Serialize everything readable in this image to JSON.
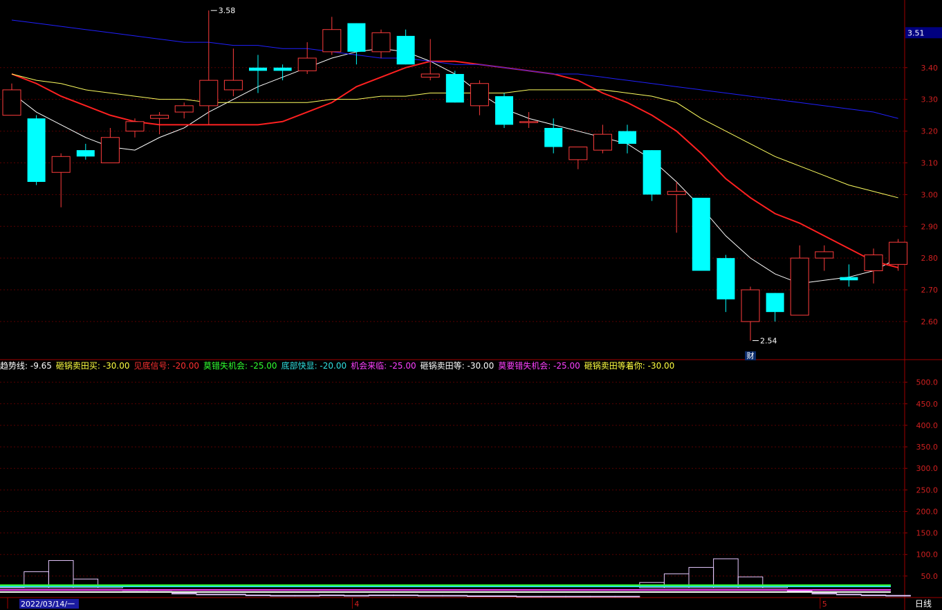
{
  "chart_data": {
    "type": "candlestick",
    "period_label": "日线",
    "price_axis": {
      "ticks": [
        3.4,
        3.3,
        3.2,
        3.1,
        3.0,
        2.9,
        2.8,
        2.7,
        2.6
      ],
      "tick_labels": [
        "3.40",
        "3.30",
        "3.20",
        "3.10",
        "3.00",
        "2.90",
        "2.80",
        "2.70",
        "2.60"
      ],
      "range": [
        2.48,
        3.6
      ],
      "current_price_label": "3.51"
    },
    "indicator_axis": {
      "ticks": [
        500,
        450,
        400,
        350,
        300,
        250,
        200,
        150,
        100,
        50
      ],
      "tick_labels": [
        "500.0",
        "450.0",
        "400.0",
        "350.0",
        "300.0",
        "250.0",
        "200.0",
        "150.0",
        "100.0",
        "50.0"
      ],
      "range": [
        0,
        530
      ]
    },
    "x_axis_labels": [
      {
        "index": 0,
        "text": "2022/03/14/一"
      },
      {
        "index": 14,
        "text": "4"
      },
      {
        "index": 33,
        "text": "5"
      }
    ],
    "annotations": [
      {
        "index": 8,
        "value": 3.58,
        "text": "3.58"
      },
      {
        "index": 30,
        "value": 2.54,
        "text": "2.54"
      },
      {
        "index": 30,
        "text": "财"
      }
    ],
    "candles": [
      {
        "o": 3.25,
        "h": 3.35,
        "l": 3.25,
        "c": 3.33
      },
      {
        "o": 3.24,
        "h": 3.25,
        "l": 3.03,
        "c": 3.04
      },
      {
        "o": 3.07,
        "h": 3.13,
        "l": 2.96,
        "c": 3.12
      },
      {
        "o": 3.14,
        "h": 3.16,
        "l": 3.11,
        "c": 3.12
      },
      {
        "o": 3.1,
        "h": 3.21,
        "l": 3.1,
        "c": 3.18
      },
      {
        "o": 3.2,
        "h": 3.24,
        "l": 3.18,
        "c": 3.23
      },
      {
        "o": 3.24,
        "h": 3.26,
        "l": 3.19,
        "c": 3.25
      },
      {
        "o": 3.26,
        "h": 3.29,
        "l": 3.24,
        "c": 3.28
      },
      {
        "o": 3.28,
        "h": 3.58,
        "l": 3.22,
        "c": 3.36
      },
      {
        "o": 3.33,
        "h": 3.46,
        "l": 3.31,
        "c": 3.36
      },
      {
        "o": 3.4,
        "h": 3.44,
        "l": 3.32,
        "c": 3.39
      },
      {
        "o": 3.4,
        "h": 3.41,
        "l": 3.36,
        "c": 3.39
      },
      {
        "o": 3.39,
        "h": 3.48,
        "l": 3.38,
        "c": 3.43
      },
      {
        "o": 3.45,
        "h": 3.56,
        "l": 3.44,
        "c": 3.52
      },
      {
        "o": 3.54,
        "h": 3.54,
        "l": 3.41,
        "c": 3.45
      },
      {
        "o": 3.45,
        "h": 3.52,
        "l": 3.43,
        "c": 3.51
      },
      {
        "o": 3.5,
        "h": 3.52,
        "l": 3.41,
        "c": 3.41
      },
      {
        "o": 3.37,
        "h": 3.49,
        "l": 3.36,
        "c": 3.38
      },
      {
        "o": 3.38,
        "h": 3.39,
        "l": 3.29,
        "c": 3.29
      },
      {
        "o": 3.28,
        "h": 3.36,
        "l": 3.25,
        "c": 3.35
      },
      {
        "o": 3.31,
        "h": 3.32,
        "l": 3.21,
        "c": 3.22
      },
      {
        "o": 3.23,
        "h": 3.26,
        "l": 3.21,
        "c": 3.23
      },
      {
        "o": 3.21,
        "h": 3.24,
        "l": 3.13,
        "c": 3.15
      },
      {
        "o": 3.11,
        "h": 3.15,
        "l": 3.08,
        "c": 3.15
      },
      {
        "o": 3.14,
        "h": 3.22,
        "l": 3.13,
        "c": 3.19
      },
      {
        "o": 3.2,
        "h": 3.22,
        "l": 3.13,
        "c": 3.16
      },
      {
        "o": 3.14,
        "h": 3.14,
        "l": 2.98,
        "c": 3.0
      },
      {
        "o": 3.0,
        "h": 3.04,
        "l": 2.88,
        "c": 3.01
      },
      {
        "o": 2.99,
        "h": 2.99,
        "l": 2.76,
        "c": 2.76
      },
      {
        "o": 2.8,
        "h": 2.81,
        "l": 2.63,
        "c": 2.67
      },
      {
        "o": 2.6,
        "h": 2.71,
        "l": 2.54,
        "c": 2.7
      },
      {
        "o": 2.69,
        "h": 2.69,
        "l": 2.6,
        "c": 2.63
      },
      {
        "o": 2.62,
        "h": 2.84,
        "l": 2.62,
        "c": 2.8
      },
      {
        "o": 2.8,
        "h": 2.84,
        "l": 2.76,
        "c": 2.82
      },
      {
        "o": 2.74,
        "h": 2.78,
        "l": 2.71,
        "c": 2.73
      },
      {
        "o": 2.76,
        "h": 2.83,
        "l": 2.72,
        "c": 2.81
      },
      {
        "o": 2.78,
        "h": 2.86,
        "l": 2.76,
        "c": 2.85
      }
    ],
    "ma_series": [
      {
        "color": "#ffffff",
        "values": [
          3.32,
          3.26,
          3.22,
          3.18,
          3.15,
          3.14,
          3.18,
          3.21,
          3.26,
          3.3,
          3.34,
          3.37,
          3.4,
          3.43,
          3.45,
          3.46,
          3.45,
          3.42,
          3.38,
          3.32,
          3.27,
          3.24,
          3.22,
          3.2,
          3.18,
          3.16,
          3.11,
          3.04,
          2.96,
          2.87,
          2.8,
          2.75,
          2.72,
          2.73,
          2.74,
          2.76,
          2.8
        ]
      },
      {
        "color": "#ff2020",
        "values": [
          3.38,
          3.35,
          3.31,
          3.28,
          3.25,
          3.23,
          3.22,
          3.22,
          3.22,
          3.22,
          3.22,
          3.23,
          3.26,
          3.29,
          3.34,
          3.37,
          3.4,
          3.42,
          3.42,
          3.41,
          3.4,
          3.39,
          3.38,
          3.36,
          3.32,
          3.29,
          3.25,
          3.2,
          3.13,
          3.05,
          2.99,
          2.94,
          2.91,
          2.87,
          2.83,
          2.79,
          2.77
        ]
      },
      {
        "color": "#ffff60",
        "values": [
          3.38,
          3.36,
          3.35,
          3.33,
          3.32,
          3.31,
          3.3,
          3.3,
          3.29,
          3.29,
          3.29,
          3.29,
          3.29,
          3.3,
          3.3,
          3.31,
          3.31,
          3.32,
          3.32,
          3.32,
          3.32,
          3.33,
          3.33,
          3.33,
          3.33,
          3.32,
          3.31,
          3.29,
          3.24,
          3.2,
          3.16,
          3.12,
          3.09,
          3.06,
          3.03,
          3.01,
          2.99
        ]
      },
      {
        "color": "#2020ff",
        "values": [
          3.55,
          3.54,
          3.53,
          3.52,
          3.51,
          3.5,
          3.49,
          3.48,
          3.48,
          3.47,
          3.47,
          3.46,
          3.46,
          3.45,
          3.44,
          3.43,
          3.43,
          3.42,
          3.41,
          3.41,
          3.4,
          3.39,
          3.38,
          3.38,
          3.37,
          3.36,
          3.35,
          3.34,
          3.33,
          3.32,
          3.31,
          3.3,
          3.29,
          3.28,
          3.27,
          3.26,
          3.24
        ]
      }
    ],
    "volume": [
      23,
      60,
      86,
      43,
      25,
      18,
      14,
      10,
      8,
      8,
      6,
      5,
      5,
      6,
      5,
      6,
      6,
      5,
      5,
      4,
      4,
      3,
      3,
      3,
      3,
      3,
      35,
      55,
      70,
      90,
      48,
      25,
      15,
      10,
      8,
      6,
      5
    ],
    "indicator_legend": [
      {
        "text": "趋势线: -9.65",
        "color": "#ffffff"
      },
      {
        "text": "砸锅卖田买: -30.00",
        "color": "#ffff40"
      },
      {
        "text": "见底信号: -20.00",
        "color": "#ff3030"
      },
      {
        "text": "莫错失机会: -25.00",
        "color": "#30ff30"
      },
      {
        "text": "底部快显: -20.00",
        "color": "#30e0e0"
      },
      {
        "text": "机会来临: -25.00",
        "color": "#ff40ff"
      },
      {
        "text": "砸锅卖田等: -30.00",
        "color": "#ffffff"
      },
      {
        "text": "莫要错失机会: -25.00",
        "color": "#ff40ff"
      },
      {
        "text": "砸锅卖田等着你: -30.00",
        "color": "#ffff40"
      }
    ]
  }
}
